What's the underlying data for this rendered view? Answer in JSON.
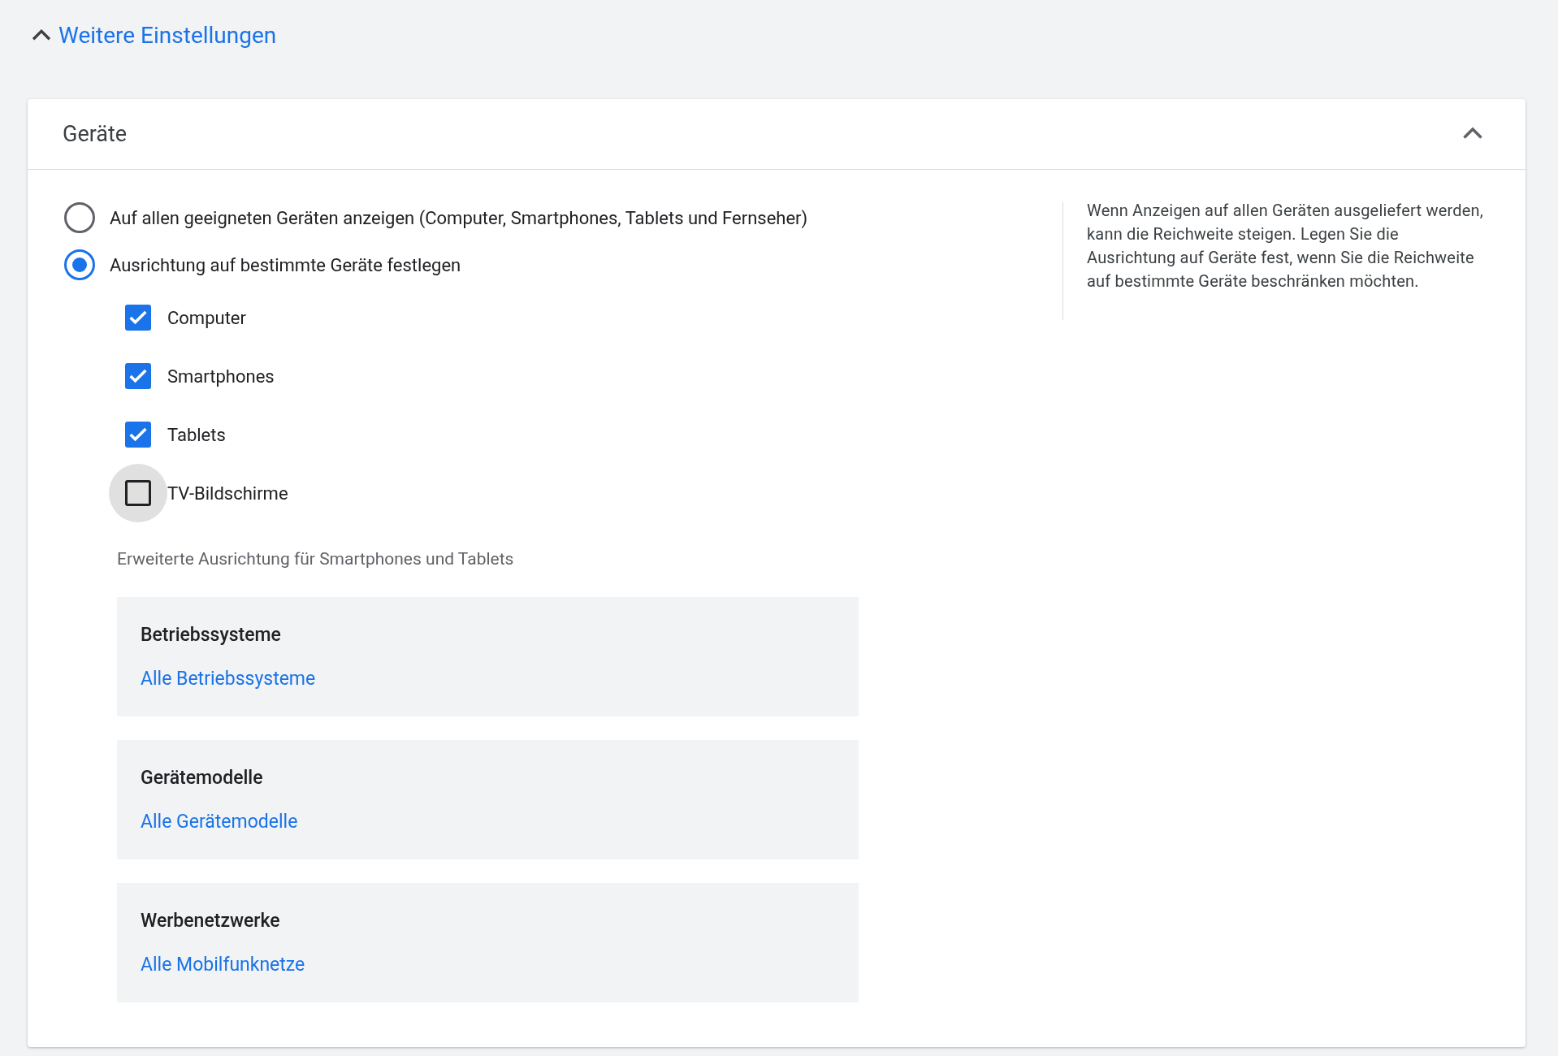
{
  "more_settings": {
    "label": "Weitere Einstellungen",
    "expanded": true
  },
  "panel": {
    "title": "Geräte",
    "expanded": true,
    "options": [
      {
        "label": "Auf allen geeigneten Geräten anzeigen (Computer, Smartphones, Tablets und Fernseher)",
        "selected": false
      },
      {
        "label": "Ausrichtung auf bestimmte Geräte festlegen",
        "selected": true
      }
    ],
    "devices": [
      {
        "label": "Computer",
        "checked": true,
        "focused": false
      },
      {
        "label": "Smartphones",
        "checked": true,
        "focused": false
      },
      {
        "label": "Tablets",
        "checked": true,
        "focused": false
      },
      {
        "label": "TV-Bildschirme",
        "checked": false,
        "focused": true
      }
    ],
    "advanced_label": "Erweiterte Ausrichtung für Smartphones und Tablets",
    "sections": [
      {
        "title": "Betriebssysteme",
        "link": "Alle Betriebssysteme"
      },
      {
        "title": "Gerätemodelle",
        "link": "Alle Gerätemodelle"
      },
      {
        "title": "Werbenetzwerke",
        "link": "Alle Mobilfunknetze"
      }
    ],
    "help": "Wenn Anzeigen auf allen Geräten ausgeliefert werden, kann die Reichweite steigen. Legen Sie die Ausrichtung auf Geräte fest, wenn Sie die Reichweite auf bestimmte Geräte beschränken möchten."
  }
}
